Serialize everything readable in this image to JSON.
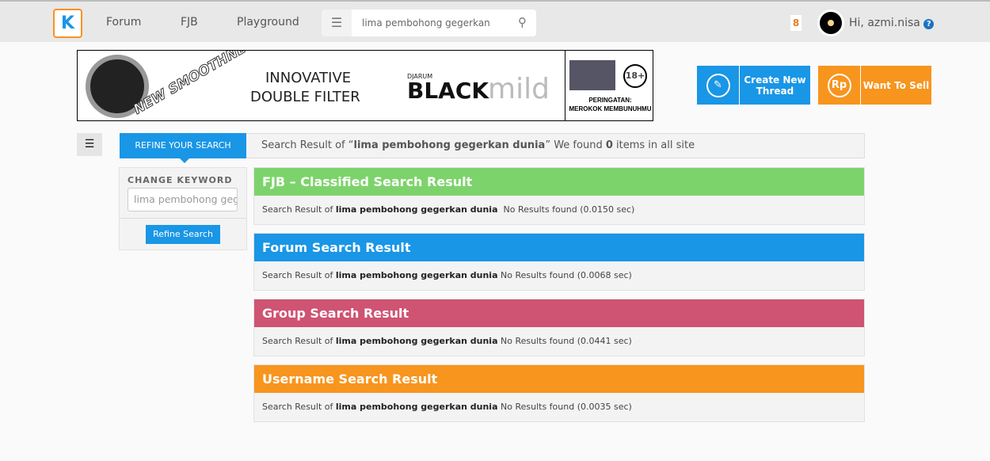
{
  "header": {
    "logo": "K",
    "nav": [
      "Forum",
      "FJB",
      "Playground"
    ],
    "search_value": "lima pembohong gegerkan dunia",
    "notifications": "8",
    "greeting": "Hi, azmi.nisa",
    "help": "?"
  },
  "banner": {
    "brand": "DJARUM",
    "product_black": "BLACK",
    "product_mild": "mild",
    "tagline_1": "INNOVATIVE",
    "tagline_2": "DOUBLE FILTER",
    "slogan": "NEW SMOOTHNESS",
    "age": "18+",
    "warning_1": "PERINGATAN:",
    "warning_2": "MEROKOK MEMBUNUHMU"
  },
  "actions": {
    "create_label": "Create New Thread",
    "sell_label": "Want To Sell",
    "sell_icon": "Rp"
  },
  "refine": {
    "tab": "REFINE YOUR SEARCH",
    "change_keyword": "CHANGE KEYWORD",
    "keyword": "lima pembohong gegerkan dunia",
    "button": "Refine Search"
  },
  "summary": {
    "prefix": "Search Result of “",
    "query": "lima pembohong gegerkan dunia",
    "mid": "” We found ",
    "count": "0",
    "suffix": " items in all site"
  },
  "results": [
    {
      "title": "FJB – Classified Search Result",
      "color": "#7dd36b",
      "prefix": "Search Result of ",
      "query": "lima pembohong gegerkan dunia",
      "status": "  No Results found (0.0150 sec)"
    },
    {
      "title": "Forum Search Result",
      "color": "#1996e6",
      "prefix": "Search Result of ",
      "query": "lima pembohong gegerkan dunia",
      "status": " No Results found (0.0068 sec)"
    },
    {
      "title": "Group Search Result",
      "color": "#cf5372",
      "prefix": "Search Result of ",
      "query": "lima pembohong gegerkan dunia",
      "status": " No Results found (0.0441 sec)"
    },
    {
      "title": "Username Search Result",
      "color": "#f7951e",
      "prefix": "Search Result of ",
      "query": "lima pembohong gegerkan dunia",
      "status": " No Results found (0.0035 sec)"
    }
  ]
}
